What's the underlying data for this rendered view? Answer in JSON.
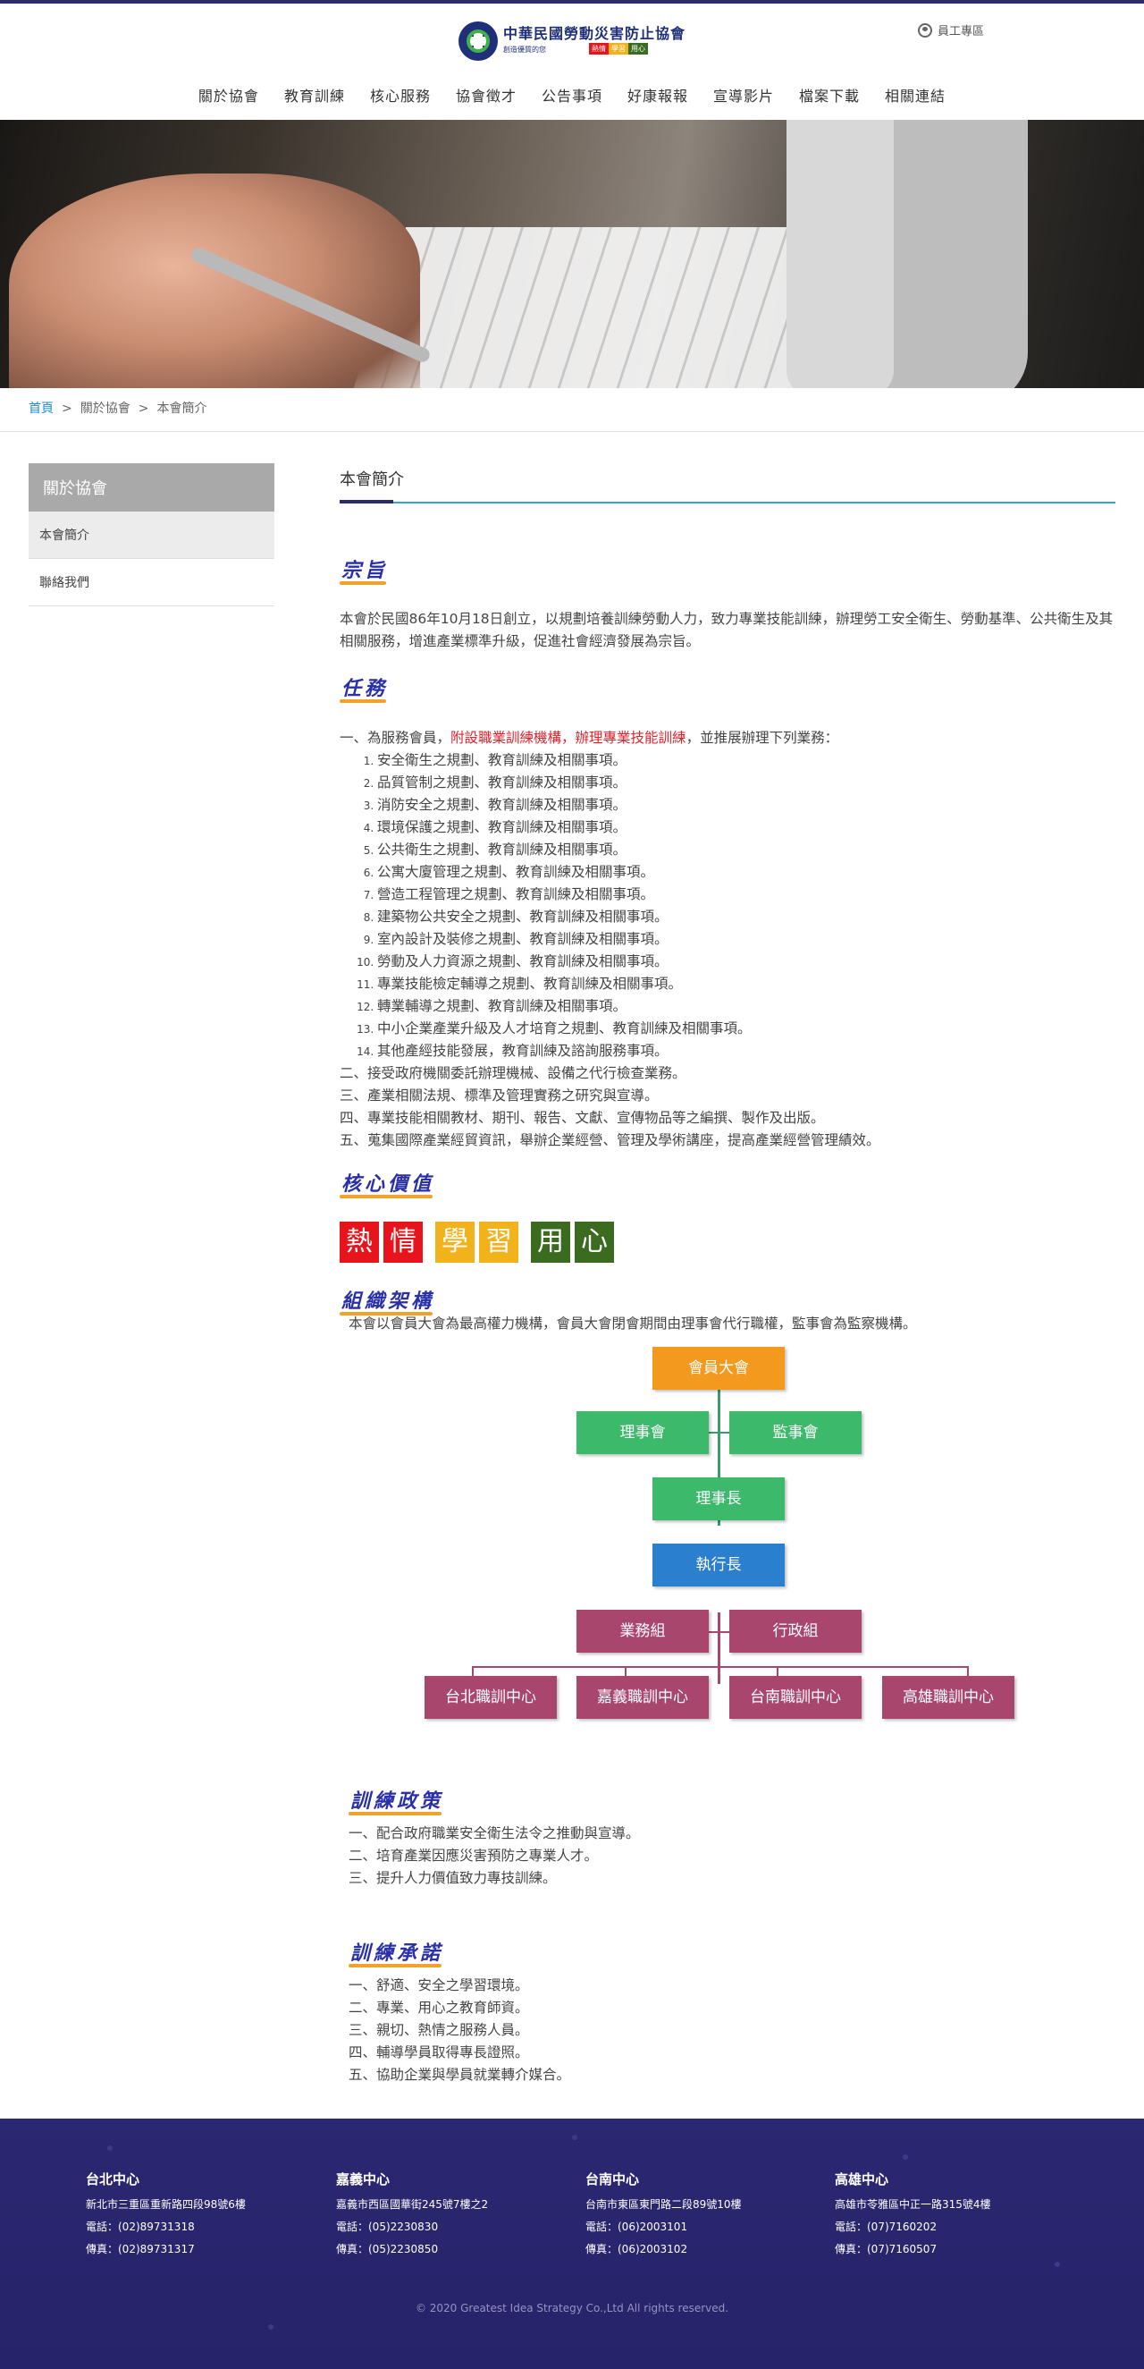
{
  "header": {
    "logo_title": "中華民國勞動災害防止協會",
    "logo_subtitle": "創造優質的您",
    "logo_tags": [
      "熱情",
      "學習",
      "用心"
    ],
    "staff_link": "員工專區"
  },
  "nav": [
    "關於協會",
    "教育訓練",
    "核心服務",
    "協會徵才",
    "公告事項",
    "好康報報",
    "宣導影片",
    "檔案下載",
    "相關連結"
  ],
  "breadcrumb": {
    "home": "首頁",
    "sep": ">",
    "items": [
      "關於協會",
      "本會簡介"
    ]
  },
  "sidebar": {
    "title": "關於協會",
    "items": [
      "本會簡介",
      "聯絡我們"
    ]
  },
  "main": {
    "title": "本會簡介",
    "sections": {
      "purpose": {
        "heading": "宗旨",
        "text": "本會於民國86年10月18日創立，以規劃培養訓練勞動人力，致力專業技能訓練，辦理勞工安全衛生、勞動基準、公共衛生及其相關服務，增進產業標準升級，促進社會經濟發展為宗旨。"
      },
      "mission": {
        "heading": "任務",
        "item1_prefix": "一、為服務會員，",
        "item1_red1": "附設職業訓練機構",
        "item1_comma": "，",
        "item1_red2": "辦理專業技能訓練",
        "item1_suffix": "，並推展辦理下列業務：",
        "subitems": [
          "安全衛生之規劃、教育訓練及相關事項。",
          "品質管制之規劃、教育訓練及相關事項。",
          "消防安全之規劃、教育訓練及相關事項。",
          "環境保護之規劃、教育訓練及相關事項。",
          "公共衛生之規劃、教育訓練及相關事項。",
          "公寓大廈管理之規劃、教育訓練及相關事項。",
          "營造工程管理之規劃、教育訓練及相關事項。",
          "建築物公共安全之規劃、教育訓練及相關事項。",
          "室內設計及裝修之規劃、教育訓練及相關事項。",
          "勞動及人力資源之規劃、教育訓練及相關事項。",
          "專業技能檢定輔導之規劃、教育訓練及相關事項。",
          "轉業輔導之規劃、教育訓練及相關事項。",
          "中小企業產業升級及人才培育之規劃、教育訓練及相關事項。",
          "其他產經技能發展，教育訓練及諮詢服務事項。"
        ],
        "others": [
          "二、接受政府機關委託辦理機械、設備之代行檢查業務。",
          "三、產業相關法規、標準及管理實務之研究與宣導。",
          "四、專業技能相關教材、期刊、報告、文獻、宣傳物品等之編撰、製作及出版。",
          "五、蒐集國際產業經貿資訊，舉辦企業經營、管理及學術講座，提高產業經營管理績效。"
        ]
      },
      "values": {
        "heading": "核心價值",
        "chars": [
          "熱",
          "情",
          "學",
          "習",
          "用",
          "心"
        ],
        "colors": [
          "#e8141c",
          "#f2b21b",
          "#3a6b1f"
        ]
      },
      "org": {
        "heading": "組織架構",
        "text": "本會以會員大會為最高權力機構，會員大會閉會期間由理事會代行職權，監事會為監察機構。",
        "nodes": {
          "assembly": "會員大會",
          "board": "理事會",
          "supervisors": "監事會",
          "chairman": "理事長",
          "ceo": "執行長",
          "business": "業務組",
          "admin": "行政組",
          "centers": [
            "台北職訓中心",
            "嘉義職訓中心",
            "台南職訓中心",
            "高雄職訓中心"
          ]
        },
        "colors": {
          "orange": "#f39a1e",
          "green": "#3db96b",
          "blue": "#2a7fcf",
          "purple": "#a9466e"
        }
      },
      "policy": {
        "heading": "訓練政策",
        "items": [
          "一、配合政府職業安全衛生法令之推動與宣導。",
          "二、培育產業因應災害預防之專業人才。",
          "三、提升人力價值致力專技訓練。"
        ]
      },
      "promise": {
        "heading": "訓練承諾",
        "items": [
          "一、舒適、安全之學習環境。",
          "二、專業、用心之教育師資。",
          "三、親切、熱情之服務人員。",
          "四、輔導學員取得專長證照。",
          "五、協助企業與學員就業轉介媒合。"
        ]
      }
    }
  },
  "footer": {
    "centers": [
      {
        "name": "台北中心",
        "address": "新北市三重區重新路四段98號6樓",
        "phone": "電話：(02)89731318",
        "fax": "傳真：(02)89731317"
      },
      {
        "name": "嘉義中心",
        "address": "嘉義市西區國華街245號7樓之2",
        "phone": "電話：(05)2230830",
        "fax": "傳真：(05)2230850"
      },
      {
        "name": "台南中心",
        "address": "台南市東區東門路二段89號10樓",
        "phone": "電話：(06)2003101",
        "fax": "傳真：(06)2003102"
      },
      {
        "name": "高雄中心",
        "address": "高雄市苓雅區中正一路315號4樓",
        "phone": "電話：(07)7160202",
        "fax": "傳真：(07)7160507"
      }
    ],
    "copyright": "© 2020 Greatest Idea Strategy Co.,Ltd All rights reserved."
  }
}
